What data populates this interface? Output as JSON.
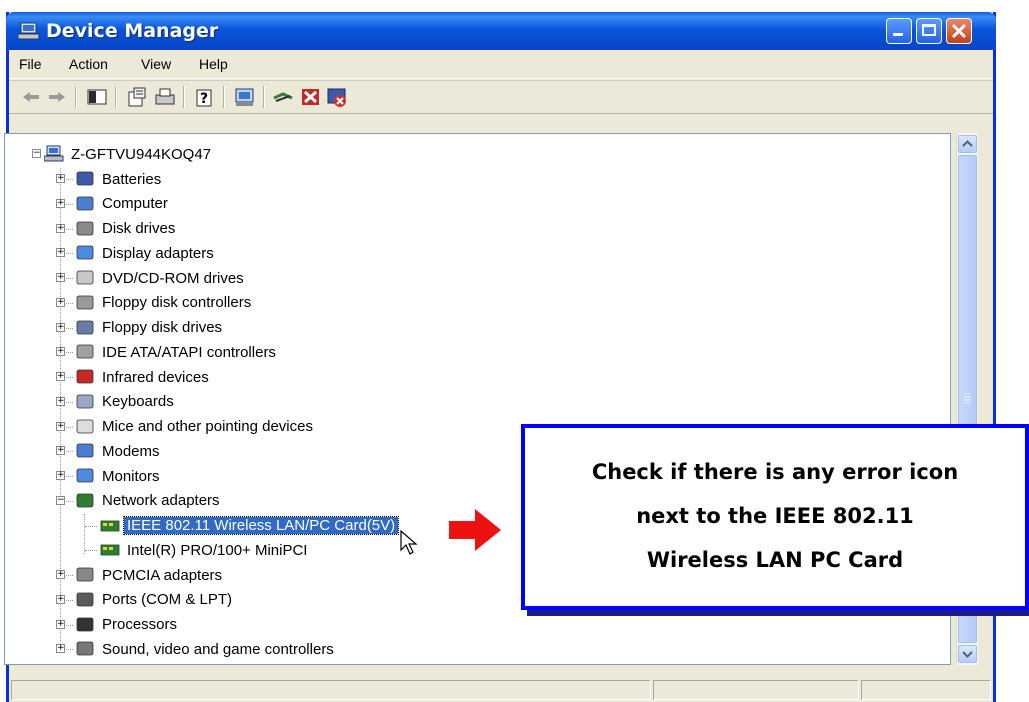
{
  "window": {
    "title": "Device Manager"
  },
  "menu": [
    "File",
    "Action",
    "View",
    "Help"
  ],
  "tree": {
    "root": "Z-GFTVU944KOQ47",
    "categories": [
      {
        "label": "Batteries",
        "icon": "battery-icon",
        "expanded": false
      },
      {
        "label": "Computer",
        "icon": "computer-icon",
        "expanded": false
      },
      {
        "label": "Disk drives",
        "icon": "disk-drive-icon",
        "expanded": false
      },
      {
        "label": "Display adapters",
        "icon": "display-adapter-icon",
        "expanded": false
      },
      {
        "label": "DVD/CD-ROM drives",
        "icon": "cd-drive-icon",
        "expanded": false
      },
      {
        "label": "Floppy disk controllers",
        "icon": "floppy-controller-icon",
        "expanded": false
      },
      {
        "label": "Floppy disk drives",
        "icon": "floppy-drive-icon",
        "expanded": false
      },
      {
        "label": "IDE ATA/ATAPI controllers",
        "icon": "ide-controller-icon",
        "expanded": false
      },
      {
        "label": "Infrared devices",
        "icon": "infrared-icon",
        "expanded": false
      },
      {
        "label": "Keyboards",
        "icon": "keyboard-icon",
        "expanded": false
      },
      {
        "label": "Mice and other pointing devices",
        "icon": "mouse-icon",
        "expanded": false
      },
      {
        "label": "Modems",
        "icon": "modem-icon",
        "expanded": false
      },
      {
        "label": "Monitors",
        "icon": "monitor-icon",
        "expanded": false
      },
      {
        "label": "Network adapters",
        "icon": "network-adapter-icon",
        "expanded": true,
        "children": [
          {
            "label": "IEEE 802.11 Wireless LAN/PC Card(5V)",
            "icon": "network-card-icon",
            "selected": true
          },
          {
            "label": "Intel(R) PRO/100+ MiniPCI",
            "icon": "network-card-icon",
            "selected": false
          }
        ]
      },
      {
        "label": "PCMCIA adapters",
        "icon": "pcmcia-icon",
        "expanded": false
      },
      {
        "label": "Ports (COM & LPT)",
        "icon": "port-icon",
        "expanded": false
      },
      {
        "label": "Processors",
        "icon": "processor-icon",
        "expanded": false
      },
      {
        "label": "Sound, video and game controllers",
        "icon": "sound-icon",
        "expanded": false
      }
    ]
  },
  "callout": {
    "lines": [
      "Check if there is any error icon",
      "next to the IEEE 802.11",
      "Wireless LAN PC Card"
    ]
  },
  "colors": {
    "selection": "#316ac5",
    "callout_border": "#0000ff",
    "arrow": "#ee1111",
    "titlebar": "#0a55d8"
  }
}
